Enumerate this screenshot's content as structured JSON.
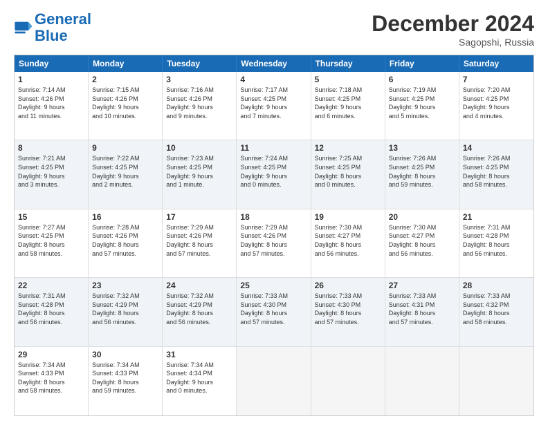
{
  "header": {
    "logo_line1": "General",
    "logo_line2": "Blue",
    "month_title": "December 2024",
    "location": "Sagopshi, Russia"
  },
  "weekdays": [
    "Sunday",
    "Monday",
    "Tuesday",
    "Wednesday",
    "Thursday",
    "Friday",
    "Saturday"
  ],
  "rows": [
    [
      {
        "day": "1",
        "lines": [
          "Sunrise: 7:14 AM",
          "Sunset: 4:26 PM",
          "Daylight: 9 hours",
          "and 11 minutes."
        ]
      },
      {
        "day": "2",
        "lines": [
          "Sunrise: 7:15 AM",
          "Sunset: 4:26 PM",
          "Daylight: 9 hours",
          "and 10 minutes."
        ]
      },
      {
        "day": "3",
        "lines": [
          "Sunrise: 7:16 AM",
          "Sunset: 4:26 PM",
          "Daylight: 9 hours",
          "and 9 minutes."
        ]
      },
      {
        "day": "4",
        "lines": [
          "Sunrise: 7:17 AM",
          "Sunset: 4:25 PM",
          "Daylight: 9 hours",
          "and 7 minutes."
        ]
      },
      {
        "day": "5",
        "lines": [
          "Sunrise: 7:18 AM",
          "Sunset: 4:25 PM",
          "Daylight: 9 hours",
          "and 6 minutes."
        ]
      },
      {
        "day": "6",
        "lines": [
          "Sunrise: 7:19 AM",
          "Sunset: 4:25 PM",
          "Daylight: 9 hours",
          "and 5 minutes."
        ]
      },
      {
        "day": "7",
        "lines": [
          "Sunrise: 7:20 AM",
          "Sunset: 4:25 PM",
          "Daylight: 9 hours",
          "and 4 minutes."
        ]
      }
    ],
    [
      {
        "day": "8",
        "lines": [
          "Sunrise: 7:21 AM",
          "Sunset: 4:25 PM",
          "Daylight: 9 hours",
          "and 3 minutes."
        ]
      },
      {
        "day": "9",
        "lines": [
          "Sunrise: 7:22 AM",
          "Sunset: 4:25 PM",
          "Daylight: 9 hours",
          "and 2 minutes."
        ]
      },
      {
        "day": "10",
        "lines": [
          "Sunrise: 7:23 AM",
          "Sunset: 4:25 PM",
          "Daylight: 9 hours",
          "and 1 minute."
        ]
      },
      {
        "day": "11",
        "lines": [
          "Sunrise: 7:24 AM",
          "Sunset: 4:25 PM",
          "Daylight: 9 hours",
          "and 0 minutes."
        ]
      },
      {
        "day": "12",
        "lines": [
          "Sunrise: 7:25 AM",
          "Sunset: 4:25 PM",
          "Daylight: 8 hours",
          "and 0 minutes."
        ]
      },
      {
        "day": "13",
        "lines": [
          "Sunrise: 7:26 AM",
          "Sunset: 4:25 PM",
          "Daylight: 8 hours",
          "and 59 minutes."
        ]
      },
      {
        "day": "14",
        "lines": [
          "Sunrise: 7:26 AM",
          "Sunset: 4:25 PM",
          "Daylight: 8 hours",
          "and 58 minutes."
        ]
      }
    ],
    [
      {
        "day": "15",
        "lines": [
          "Sunrise: 7:27 AM",
          "Sunset: 4:25 PM",
          "Daylight: 8 hours",
          "and 58 minutes."
        ]
      },
      {
        "day": "16",
        "lines": [
          "Sunrise: 7:28 AM",
          "Sunset: 4:26 PM",
          "Daylight: 8 hours",
          "and 57 minutes."
        ]
      },
      {
        "day": "17",
        "lines": [
          "Sunrise: 7:29 AM",
          "Sunset: 4:26 PM",
          "Daylight: 8 hours",
          "and 57 minutes."
        ]
      },
      {
        "day": "18",
        "lines": [
          "Sunrise: 7:29 AM",
          "Sunset: 4:26 PM",
          "Daylight: 8 hours",
          "and 57 minutes."
        ]
      },
      {
        "day": "19",
        "lines": [
          "Sunrise: 7:30 AM",
          "Sunset: 4:27 PM",
          "Daylight: 8 hours",
          "and 56 minutes."
        ]
      },
      {
        "day": "20",
        "lines": [
          "Sunrise: 7:30 AM",
          "Sunset: 4:27 PM",
          "Daylight: 8 hours",
          "and 56 minutes."
        ]
      },
      {
        "day": "21",
        "lines": [
          "Sunrise: 7:31 AM",
          "Sunset: 4:28 PM",
          "Daylight: 8 hours",
          "and 56 minutes."
        ]
      }
    ],
    [
      {
        "day": "22",
        "lines": [
          "Sunrise: 7:31 AM",
          "Sunset: 4:28 PM",
          "Daylight: 8 hours",
          "and 56 minutes."
        ]
      },
      {
        "day": "23",
        "lines": [
          "Sunrise: 7:32 AM",
          "Sunset: 4:29 PM",
          "Daylight: 8 hours",
          "and 56 minutes."
        ]
      },
      {
        "day": "24",
        "lines": [
          "Sunrise: 7:32 AM",
          "Sunset: 4:29 PM",
          "Daylight: 8 hours",
          "and 56 minutes."
        ]
      },
      {
        "day": "25",
        "lines": [
          "Sunrise: 7:33 AM",
          "Sunset: 4:30 PM",
          "Daylight: 8 hours",
          "and 57 minutes."
        ]
      },
      {
        "day": "26",
        "lines": [
          "Sunrise: 7:33 AM",
          "Sunset: 4:30 PM",
          "Daylight: 8 hours",
          "and 57 minutes."
        ]
      },
      {
        "day": "27",
        "lines": [
          "Sunrise: 7:33 AM",
          "Sunset: 4:31 PM",
          "Daylight: 8 hours",
          "and 57 minutes."
        ]
      },
      {
        "day": "28",
        "lines": [
          "Sunrise: 7:33 AM",
          "Sunset: 4:32 PM",
          "Daylight: 8 hours",
          "and 58 minutes."
        ]
      }
    ],
    [
      {
        "day": "29",
        "lines": [
          "Sunrise: 7:34 AM",
          "Sunset: 4:33 PM",
          "Daylight: 8 hours",
          "and 58 minutes."
        ]
      },
      {
        "day": "30",
        "lines": [
          "Sunrise: 7:34 AM",
          "Sunset: 4:33 PM",
          "Daylight: 8 hours",
          "and 59 minutes."
        ]
      },
      {
        "day": "31",
        "lines": [
          "Sunrise: 7:34 AM",
          "Sunset: 4:34 PM",
          "Daylight: 9 hours",
          "and 0 minutes."
        ]
      },
      {
        "day": "",
        "lines": []
      },
      {
        "day": "",
        "lines": []
      },
      {
        "day": "",
        "lines": []
      },
      {
        "day": "",
        "lines": []
      }
    ]
  ]
}
